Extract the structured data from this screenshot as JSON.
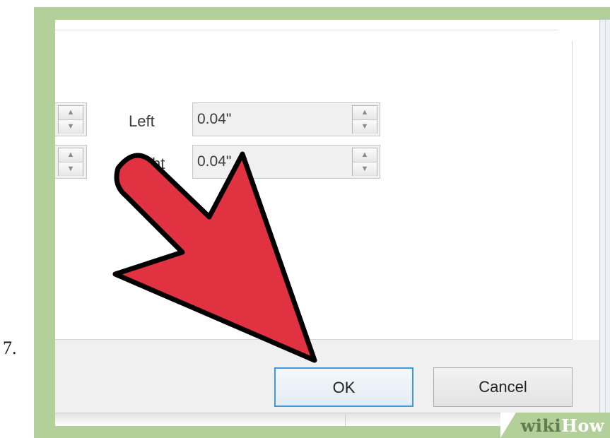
{
  "step": {
    "number": "7."
  },
  "margins": {
    "left": {
      "label": "Left",
      "value": "0.04\""
    },
    "right": {
      "label": "Right",
      "value": "0.04\""
    }
  },
  "spinner": {
    "up_icon": "▲",
    "down_icon": "▼"
  },
  "buttons": {
    "ok_label": "OK",
    "cancel_label": "Cancel"
  },
  "watermark": {
    "part1": "wiki",
    "part2": "How"
  },
  "colors": {
    "frame": "#b3cf9a",
    "arrow_fill": "#e03240",
    "arrow_stroke": "#000000",
    "ok_border": "#3c9ad8"
  }
}
